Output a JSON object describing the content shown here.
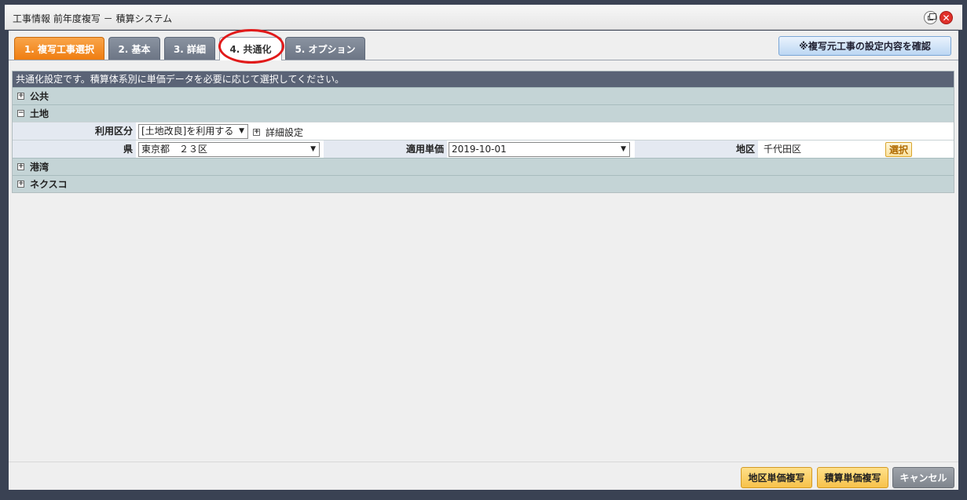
{
  "window": {
    "title": "工事情報 前年度複写 － 積算システム"
  },
  "tabs": [
    {
      "label": "1. 複写工事選択"
    },
    {
      "label": "2. 基本"
    },
    {
      "label": "3. 詳細"
    },
    {
      "label": "4. 共通化"
    },
    {
      "label": "5. オプション"
    }
  ],
  "confirm_button": "※複写元工事の設定内容を確認",
  "panel": {
    "header": "共通化設定です。積算体系別に単価データを必要に応じて選択してください。",
    "sections": [
      {
        "label": "公共",
        "toggle": "+"
      },
      {
        "label": "土地",
        "toggle": "−"
      },
      {
        "label": "港湾",
        "toggle": "+"
      },
      {
        "label": "ネクスコ",
        "toggle": "+"
      }
    ],
    "tochi": {
      "usage_label": "利用区分",
      "usage_value": "[土地改良]を利用する",
      "detail_toggle": "+",
      "detail_label": "詳細設定",
      "pref_label": "県",
      "pref_value": "東京都　２３区",
      "unit_price_label": "適用単価",
      "unit_price_value": "2019-10-01",
      "area_label": "地区",
      "area_value": "千代田区",
      "select_button": "選択"
    }
  },
  "footer": {
    "area_copy": "地区単価複写",
    "estimate_copy": "積算単価複写",
    "cancel": "キャンセル"
  },
  "colors": {
    "active_tab": "#ef7d10",
    "highlight_ring": "#e11a1a",
    "panel_header": "#5a6376",
    "section_bg": "#c4d4d6"
  }
}
